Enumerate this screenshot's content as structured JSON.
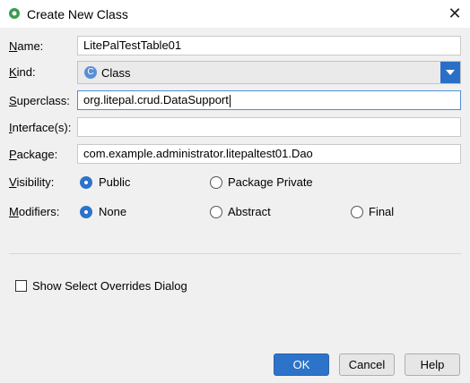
{
  "window": {
    "title": "Create New Class",
    "close_glyph": "✕"
  },
  "form": {
    "name": {
      "label": "Name:",
      "mnemonic": "N",
      "value": "LitePalTestTable01"
    },
    "kind": {
      "label": "Kind:",
      "mnemonic": "K",
      "value": "Class",
      "icon": "class-icon",
      "icon_letter": "C"
    },
    "superclass": {
      "label": "Superclass:",
      "mnemonic": "S",
      "value": "org.litepal.crud.DataSupport"
    },
    "interfaces": {
      "label": "Interface(s):",
      "mnemonic": "I",
      "value": ""
    },
    "package": {
      "label": "Package:",
      "mnemonic": "P",
      "value": "com.example.administrator.litepaltest01.Dao"
    },
    "visibility": {
      "label": "Visibility:",
      "mnemonic": "V",
      "options": [
        {
          "label": "Public",
          "checked": true
        },
        {
          "label": "Package Private",
          "checked": false
        }
      ]
    },
    "modifiers": {
      "label": "Modifiers:",
      "mnemonic": "M",
      "options": [
        {
          "label": "None",
          "checked": true
        },
        {
          "label": "Abstract",
          "checked": false
        },
        {
          "label": "Final",
          "checked": false
        }
      ]
    }
  },
  "show_overrides": {
    "label": "Show Select Overrides Dialog",
    "checked": false
  },
  "buttons": {
    "ok": "OK",
    "cancel": "Cancel",
    "help": "Help"
  },
  "colors": {
    "accent": "#2d73c9",
    "dialog_bg": "#f0f0f0"
  }
}
